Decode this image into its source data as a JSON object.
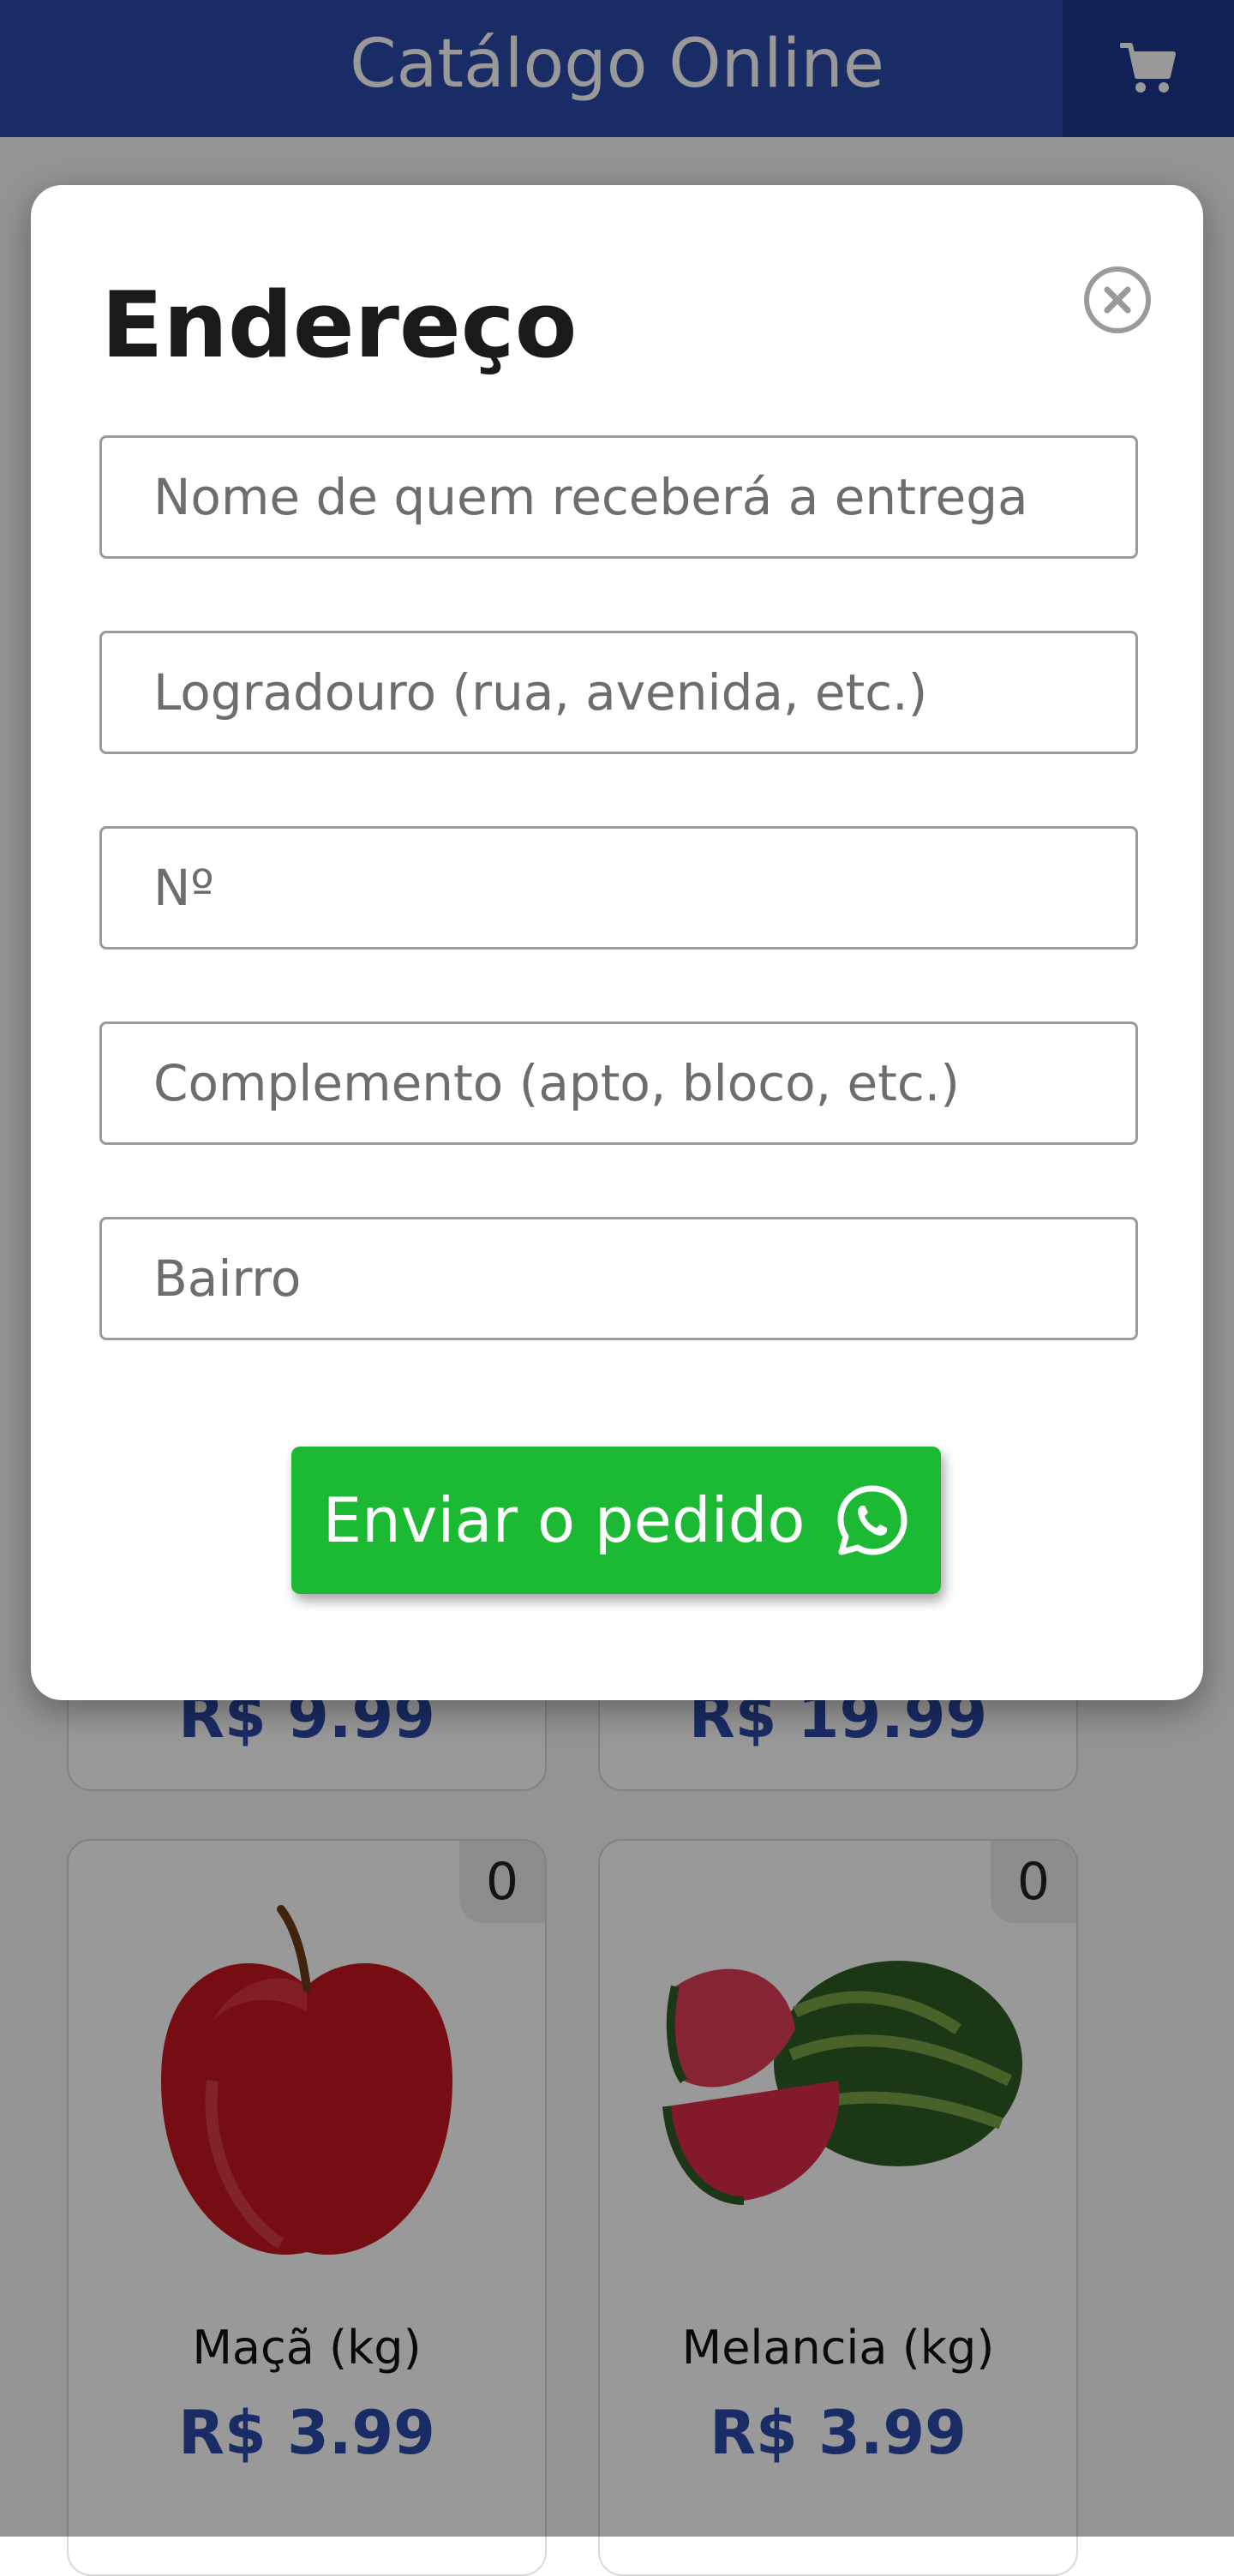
{
  "header": {
    "title": "Catálogo Online",
    "cart_icon": "cart-icon"
  },
  "products": [
    {
      "price": "R$ 9.99",
      "partial": true
    },
    {
      "price": "R$ 19.99",
      "partial": true
    },
    {
      "name": "Maçã (kg)",
      "price": "R$ 3.99",
      "qty": "0",
      "image": "apple"
    },
    {
      "name": "Melancia (kg)",
      "price": "R$ 3.99",
      "qty": "0",
      "image": "watermelon"
    }
  ],
  "modal": {
    "title": "Endereço",
    "close_icon": "close-circle-icon",
    "fields": [
      {
        "placeholder": "Nome de quem receberá a entrega",
        "value": ""
      },
      {
        "placeholder": "Logradouro (rua, avenida, etc.)",
        "value": ""
      },
      {
        "placeholder": "Nº",
        "value": ""
      },
      {
        "placeholder": "Complemento (apto, bloco, etc.)",
        "value": ""
      },
      {
        "placeholder": "Bairro",
        "value": ""
      }
    ],
    "submit_label": "Enviar o pedido",
    "submit_icon": "whatsapp-icon"
  },
  "colors": {
    "brand": "#2c4aa8",
    "brand_dark": "#1d378e",
    "whatsapp_green": "#1bb934"
  }
}
